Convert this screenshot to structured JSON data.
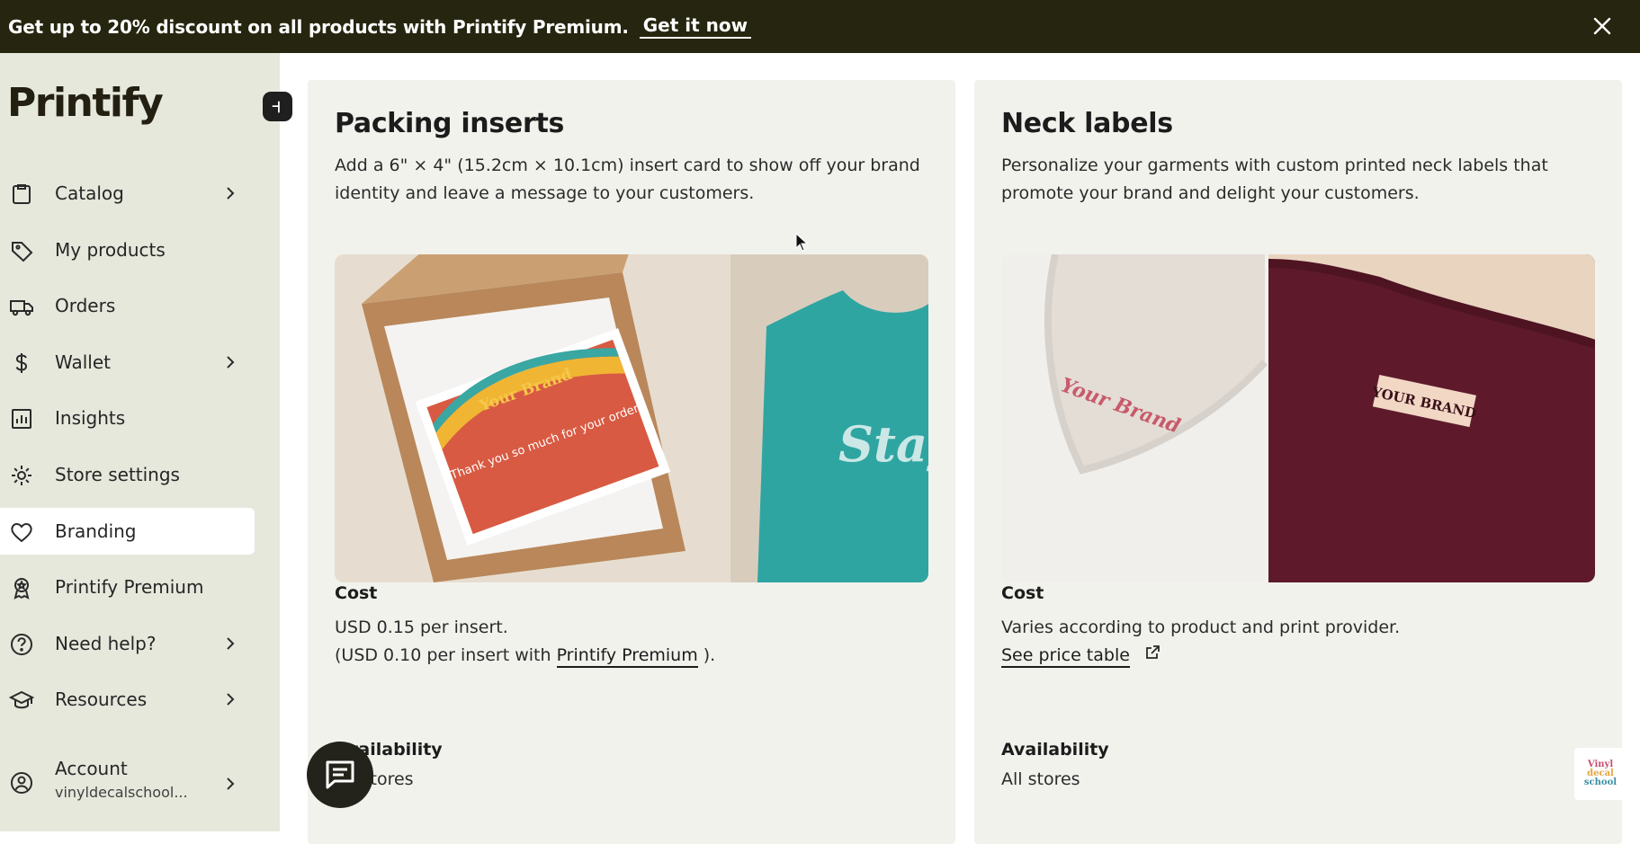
{
  "banner": {
    "text": "Get up to 20% discount on all products with Printify Premium.",
    "link": "Get it now"
  },
  "sidebar": {
    "logo": "Printify",
    "items": [
      {
        "label": "Catalog",
        "icon": "clipboard-icon",
        "chevron": true
      },
      {
        "label": "My products",
        "icon": "tag-icon",
        "chevron": false
      },
      {
        "label": "Orders",
        "icon": "truck-icon",
        "chevron": false
      },
      {
        "label": "Wallet",
        "icon": "dollar-icon",
        "chevron": true
      },
      {
        "label": "Insights",
        "icon": "bar-chart-icon",
        "chevron": false
      },
      {
        "label": "Store settings",
        "icon": "gear-icon",
        "chevron": false
      },
      {
        "label": "Branding",
        "icon": "heart-icon",
        "chevron": false,
        "active": true
      },
      {
        "label": "Printify Premium",
        "icon": "badge-icon",
        "chevron": false
      },
      {
        "label": "Need help?",
        "icon": "question-icon",
        "chevron": true
      },
      {
        "label": "Resources",
        "icon": "graduation-cap-icon",
        "chevron": true
      }
    ],
    "account": {
      "label": "Account",
      "sub": "vinyldecalschool..."
    }
  },
  "cards": [
    {
      "title": "Packing inserts",
      "description": "Add a 6\" × 4\" (15.2cm × 10.1cm) insert card to show off your brand identity and leave a message to your customers.",
      "cost_heading": "Cost",
      "cost_line1": "USD 0.15 per insert.",
      "cost_line2_prefix": "(USD 0.10 per insert with ",
      "cost_line2_link": "Printify Premium",
      "cost_line2_suffix": " ).",
      "availability_heading": "Availability",
      "availability_text": "All stores",
      "image": {
        "card_brand": "Your Brand",
        "card_message": "Thank you so much for your order",
        "shirt_text": "Stay groovy"
      }
    },
    {
      "title": "Neck labels",
      "description": "Personalize your garments with custom printed neck labels that promote your brand and delight your customers.",
      "cost_heading": "Cost",
      "cost_line1": "Varies according to product and print provider.",
      "price_link": "See price table",
      "availability_heading": "Availability",
      "availability_text": "All stores",
      "image": {
        "label_left": "Your Brand",
        "label_right": "YOUR BRAND"
      }
    }
  ],
  "watermark": [
    "Vinyl",
    "decal",
    "school"
  ],
  "colors": {
    "banner_bg": "#26250f",
    "sidebar_bg": "#e6e8dc",
    "card_bg": "#f2f2ed",
    "chat_bg": "#24231b"
  }
}
